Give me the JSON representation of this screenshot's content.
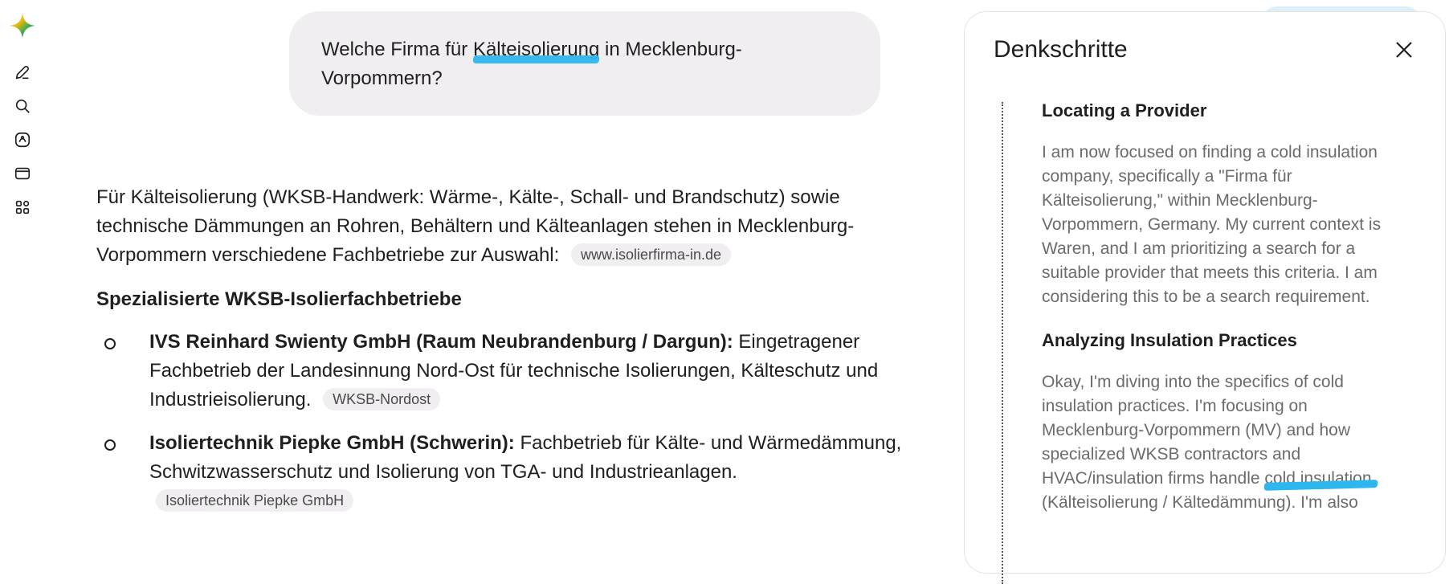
{
  "icons": {
    "logo": "gemini-sparkle-icon",
    "rail": [
      "new-chat-icon",
      "search-icon",
      "gems-icon",
      "library-icon",
      "apps-icon"
    ]
  },
  "colors": {
    "highlight": "#2eb6ee",
    "bubble": "#f0eef0",
    "muted_text": "#6b6b6b"
  },
  "user_message": {
    "before": "Welche Firma für ",
    "highlight": "Kälteisolierung",
    "after": " in Mecklenburg-Vorpommern?"
  },
  "answer": {
    "intro": "Für Kälteisolierung (WKSB-Handwerk: Wärme-, Kälte-, Schall- und Brandschutz) sowie technische Dämmungen an Rohren, Behältern und Kälteanlagen stehen in Mecklenburg-Vorpommern verschiedene Fachbetriebe zur Auswahl:",
    "intro_source": "www.isolierfirma-in.de",
    "section_title": "Spezialisierte WKSB-Isolierfachbetriebe",
    "items": [
      {
        "title": "IVS Reinhard Swienty GmbH (Raum Neubrandenburg / Dargun):",
        "text": " Eingetragener Fachbetrieb der Landesinnung Nord-Ost für technische Isolierungen, Kälteschutz und Industrieisolierung.",
        "source": "WKSB-Nordost"
      },
      {
        "title": "Isoliertechnik Piepke GmbH (Schwerin):",
        "text": " Fachbetrieb für Kälte- und Wärmedämmung, Schwitzwasserschutz und Isolierung von TGA- und Industrieanlagen.",
        "source": "Isoliertechnik Piepke GmbH"
      }
    ]
  },
  "panel": {
    "title": "Denkschritte",
    "thoughts": [
      {
        "heading": "Locating a Provider",
        "body": "I am now focused on finding a cold insulation company, specifically a \"Firma für Kälteisolierung,\" within Mecklenburg-Vorpommern, Germany. My current context is Waren, and I am prioritizing a search for a suitable provider that meets this criteria. I am considering this to be a search requirement."
      },
      {
        "heading": "Analyzing Insulation Practices",
        "body_before": "Okay, I'm diving into the specifics of cold insulation practices. I'm focusing on Mecklenburg-Vorpommern (MV) and how specialized WKSB contractors and HVAC/insulation firms handle ",
        "body_highlight": "cold insulation",
        "body_after": " (Kälteisolierung / Kältedämmung). I'm also"
      }
    ]
  }
}
